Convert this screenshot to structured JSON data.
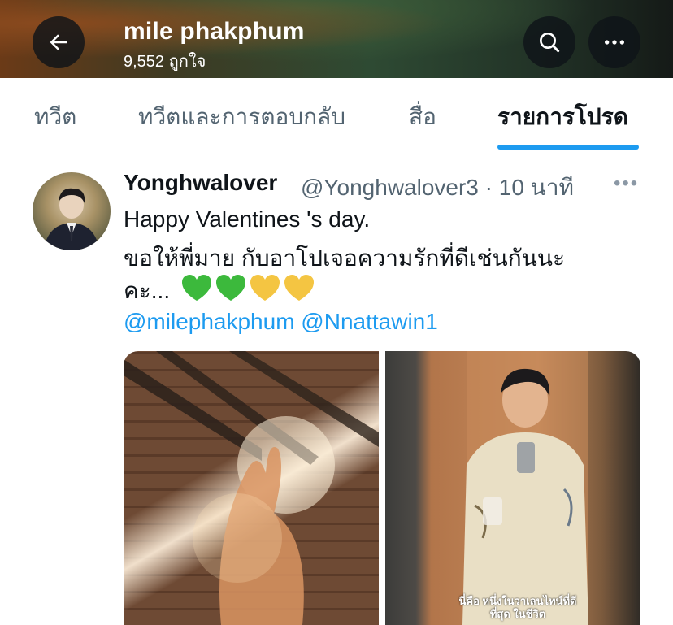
{
  "header": {
    "title": "mile phakphum",
    "subtitle": "9,552 ถูกใจ",
    "icons": [
      "back-arrow-icon",
      "search-icon",
      "more-icon"
    ]
  },
  "tabs": [
    {
      "label": "ทวีต",
      "active": false
    },
    {
      "label": "ทวีตและการตอบกลับ",
      "active": false
    },
    {
      "label": "สื่อ",
      "active": false
    },
    {
      "label": "รายการโปรด",
      "active": true
    }
  ],
  "tweet": {
    "author_name": "Yonghwalover",
    "author_handle_time": "@Yonghwalover3 · 10 นาที",
    "line1": "Happy Valentines 's  day.",
    "line2": "ขอให้พี่มาย กับอาโปเจอความรักที่ดีเช่นกันนะ",
    "line3": "คะ...",
    "emojis": [
      "green-heart",
      "green-heart",
      "yellow-heart",
      "yellow-heart"
    ],
    "mentions": "@milephakphum @Nnattawin1",
    "media_caption": "นี่คือ หนึ่งในวาเลนไทน์ที่ดีที่สุด ในชีวิต"
  },
  "colors": {
    "accent": "#1d9bf0",
    "green_heart": "#3cb93c",
    "yellow_heart": "#f4c542"
  }
}
